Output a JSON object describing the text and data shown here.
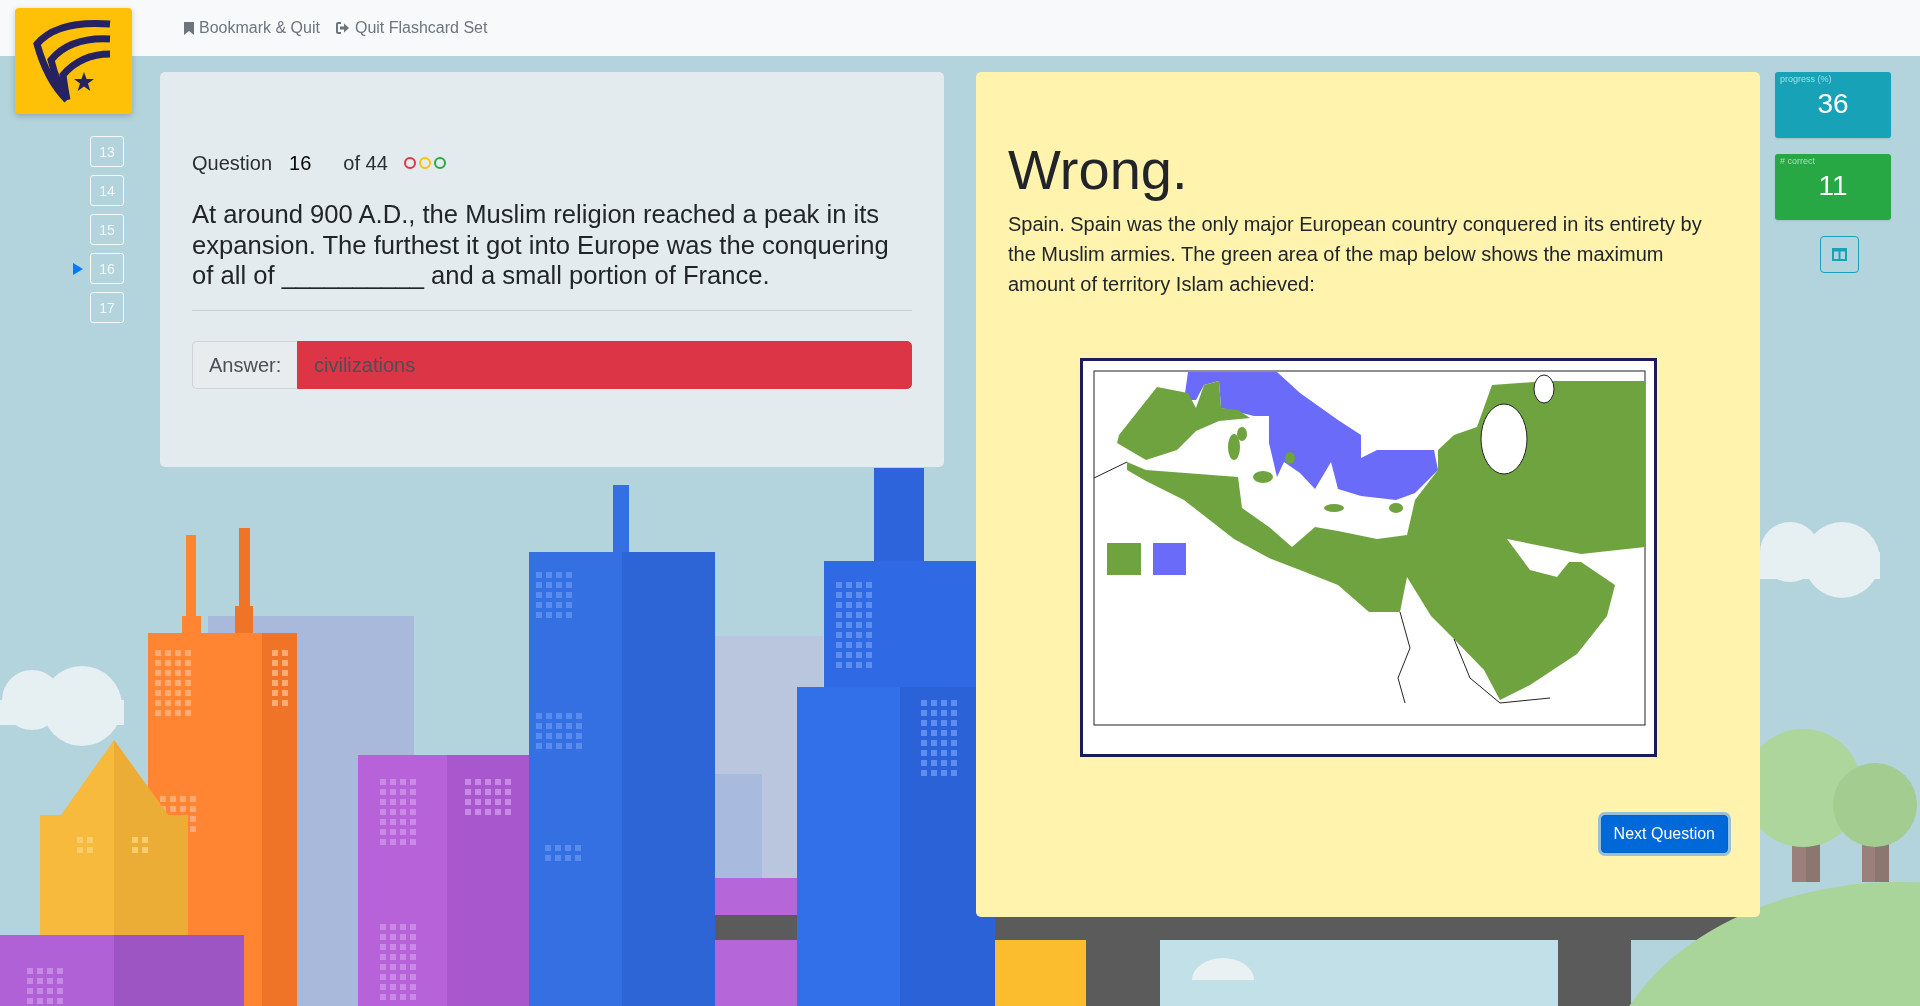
{
  "nav": {
    "links": [
      {
        "kind": "bookmark",
        "label": "Bookmark & Quit"
      },
      {
        "kind": "quit",
        "label": "Quit Flashcard Set"
      }
    ]
  },
  "question_nav": [
    {
      "label": "13",
      "selected": false
    },
    {
      "label": "14",
      "selected": false
    },
    {
      "label": "15",
      "selected": false
    },
    {
      "label": "16",
      "selected": true
    },
    {
      "label": "17",
      "selected": false
    }
  ],
  "question": {
    "label": "Question",
    "number": "16",
    "total": "of 44",
    "status_dots": [
      {
        "color": "#dc3545"
      },
      {
        "color": "#ffc107"
      },
      {
        "color": "#28a745"
      }
    ],
    "text": "At around 900 A.D., the Muslim religion reached a peak in its expansion. The furthest it got into Europe was the conquering of all of __________ and a small portion of France."
  },
  "answer": {
    "label": "Answer:",
    "value": "civilizations",
    "correct": false
  },
  "feedback": {
    "verdict": "Wrong.",
    "explanation": "Spain. Spain was the only major European country conquered in its entirety by the Muslim armies. The green area of the map below shows the maximum amount of territory Islam achieved:",
    "button": "Next Question"
  },
  "stats": [
    {
      "label": "progress (%)",
      "value": "36",
      "color": "#17a2b8"
    },
    {
      "label": "# correct",
      "value": "11",
      "color": "#28a745"
    }
  ]
}
